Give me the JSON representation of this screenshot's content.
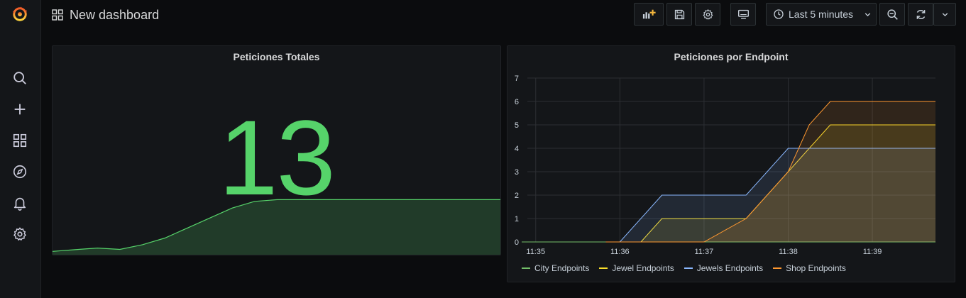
{
  "header": {
    "title": "New dashboard",
    "time_range": "Last 5 minutes"
  },
  "icons": {
    "logo": "grafana-logo",
    "search": "search-icon",
    "create": "plus-icon",
    "dashboards": "dashboards-icon",
    "explore": "compass-icon",
    "alerting": "bell-icon",
    "configuration": "gear-icon",
    "add_panel": "add-panel-icon",
    "save": "save-icon",
    "settings": "gear-icon",
    "tv_mode": "monitor-icon",
    "clock": "clock-icon",
    "zoom_out": "zoom-out-icon",
    "refresh": "refresh-icon",
    "chevron": "chevron-down-icon"
  },
  "colors": {
    "stat_green": "#56d36a",
    "city": "#73bf69",
    "jewel": "#fade2a",
    "jewels": "#8ab8ff",
    "shop": "#ff9830"
  },
  "panels": {
    "stat": {
      "title": "Peticiones Totales",
      "value": "13",
      "sparkline": [
        1,
        1.5,
        2,
        1.6,
        3,
        5,
        8,
        11,
        14,
        16,
        16.5,
        16.5,
        16.5,
        16.5,
        16.5,
        16.5,
        16.5,
        16.5,
        16.5,
        16.5,
        16.5
      ]
    },
    "graph": {
      "title": "Peticiones por Endpoint"
    }
  },
  "chart_data": {
    "type": "area",
    "title": "Peticiones por Endpoint",
    "xlabel": "",
    "ylabel": "",
    "x_ticks": [
      "11:35",
      "11:36",
      "11:37",
      "11:38",
      "11:39"
    ],
    "y_ticks": [
      0,
      1,
      2,
      3,
      4,
      5,
      6,
      7
    ],
    "ylim": [
      0,
      7
    ],
    "xlim": [
      "11:34:50",
      "11:39:45"
    ],
    "grid": true,
    "legend": "bottom",
    "series": [
      {
        "name": "City Endpoints",
        "color": "#73bf69",
        "x": [
          "11:34:50",
          "11:35:00",
          "11:39:45"
        ],
        "y": [
          0,
          0,
          0
        ]
      },
      {
        "name": "Jewel Endpoints",
        "color": "#fade2a",
        "x": [
          "11:35:50",
          "11:36:15",
          "11:36:30",
          "11:37:30",
          "11:38:00",
          "11:38:30",
          "11:39:45"
        ],
        "y": [
          0,
          0,
          1,
          1,
          3,
          5,
          5
        ]
      },
      {
        "name": "Jewels Endpoints",
        "color": "#8ab8ff",
        "x": [
          "11:35:50",
          "11:36:00",
          "11:36:30",
          "11:37:30",
          "11:38:00",
          "11:39:45"
        ],
        "y": [
          0,
          0,
          2,
          2,
          4,
          4
        ]
      },
      {
        "name": "Shop Endpoints",
        "color": "#ff9830",
        "x": [
          "11:35:50",
          "11:37:00",
          "11:37:30",
          "11:38:00",
          "11:38:15",
          "11:38:30",
          "11:39:45"
        ],
        "y": [
          0,
          0,
          1,
          3,
          5,
          6,
          6
        ]
      }
    ]
  }
}
